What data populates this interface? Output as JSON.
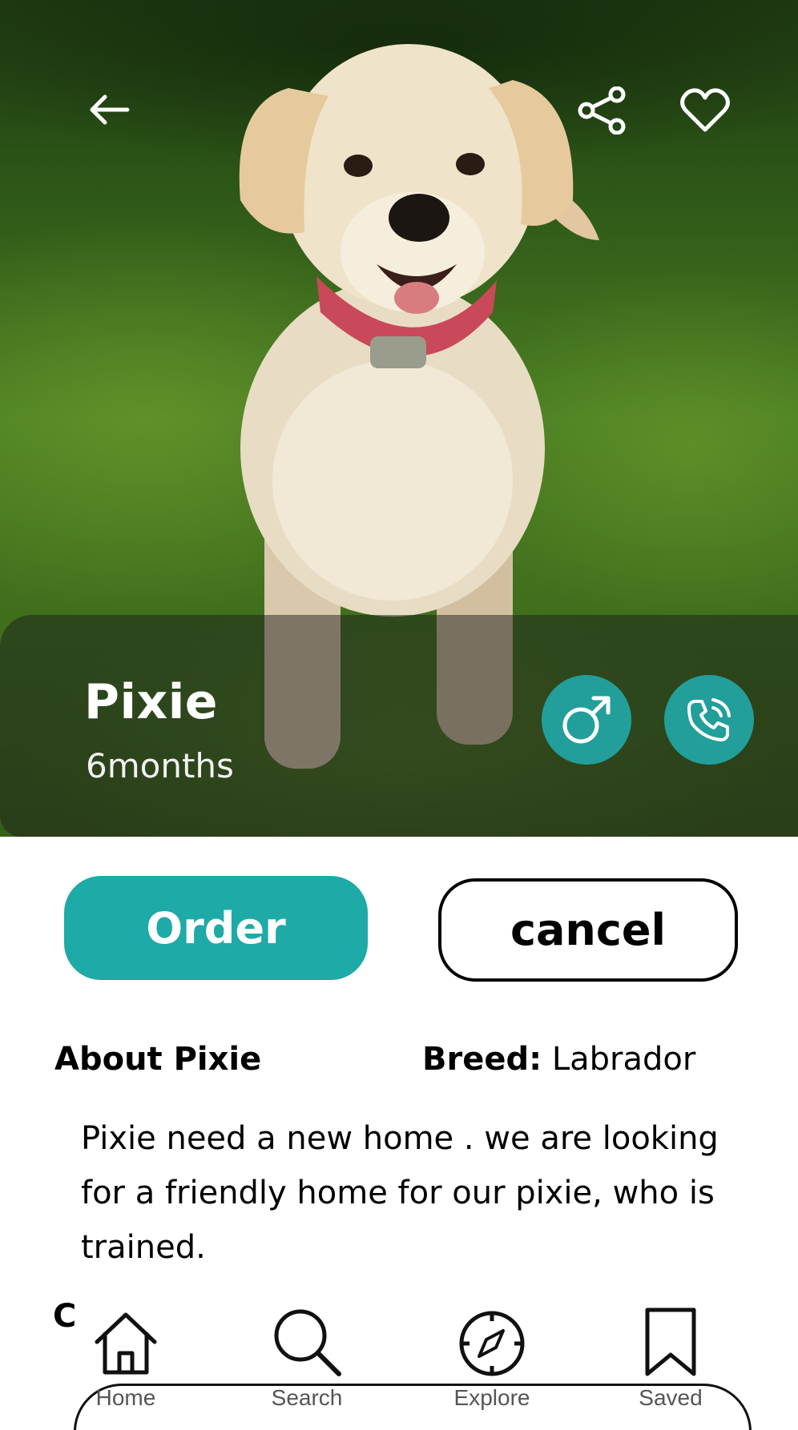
{
  "header": {
    "back_icon": "arrow-left-icon",
    "share_icon": "share-icon",
    "favorite_icon": "heart-icon"
  },
  "pet": {
    "name": "Pixie",
    "age": "6months",
    "gender_icon": "male-symbol-icon",
    "call_icon": "phone-call-icon"
  },
  "actions": {
    "order_label": "Order",
    "cancel_label": "cancel"
  },
  "about": {
    "title": "About Pixie",
    "breed_label": "Breed:",
    "breed_value": "Labrador",
    "description": "Pixie need a new home . we are looking for a friendly  home for our pixie, who is trained.",
    "next_heading_partial": "C"
  },
  "bottom_nav": {
    "items": [
      {
        "label": "Home",
        "icon": "home-icon"
      },
      {
        "label": "Search",
        "icon": "search-icon"
      },
      {
        "label": "Explore",
        "icon": "compass-icon"
      },
      {
        "label": "Saved",
        "icon": "bookmark-icon"
      }
    ]
  },
  "colors": {
    "accent": "#1eaaa7",
    "accent_dark": "#229f9a",
    "text": "#000000",
    "nav_label": "#555555"
  }
}
